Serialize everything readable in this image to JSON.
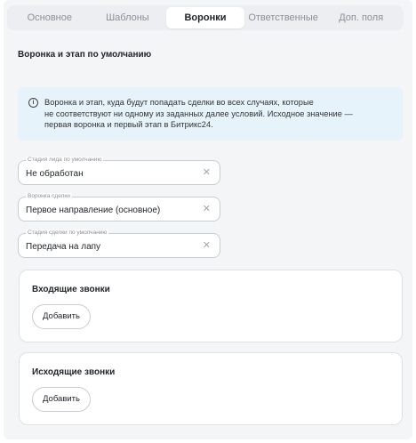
{
  "tabs": [
    {
      "label": "Основное",
      "active": false
    },
    {
      "label": "Шаблоны",
      "active": false
    },
    {
      "label": "Воронки",
      "active": true
    },
    {
      "label": "Ответственные",
      "active": false
    },
    {
      "label": "Доп. поля",
      "active": false
    }
  ],
  "section": {
    "title": "Воронка и этап по умолчанию"
  },
  "info": {
    "icon": "info-icon",
    "line1": "Воронка и этап, куда будут попадать сделки во всех случаях, которые",
    "line2": "не соответствуют ни одному из заданных далее условий. Исходное значение —",
    "line3": "первая воронка и первый этап в Битрикс24."
  },
  "fields": {
    "lead_stage": {
      "label": "Стадия лида по умолчанию",
      "value": "Не обработан",
      "clear_icon": "close-icon"
    },
    "deal_funnel": {
      "label": "Воронка сделки",
      "value": "Первое направление (основное)",
      "clear_icon": "close-icon"
    },
    "deal_stage": {
      "label": "Стадия сделки по умолчанию",
      "value": "Передача на лапу",
      "clear_icon": "close-icon"
    }
  },
  "cards": {
    "incoming": {
      "title": "Входящие звонки",
      "button": "Добавить"
    },
    "outgoing": {
      "title": "Исходящие звонки",
      "button": "Добавить"
    }
  },
  "colors": {
    "info_bg": "#e6f3fb",
    "panel_bg": "#f4f5f7",
    "active_tab_bg": "#ffffff"
  }
}
